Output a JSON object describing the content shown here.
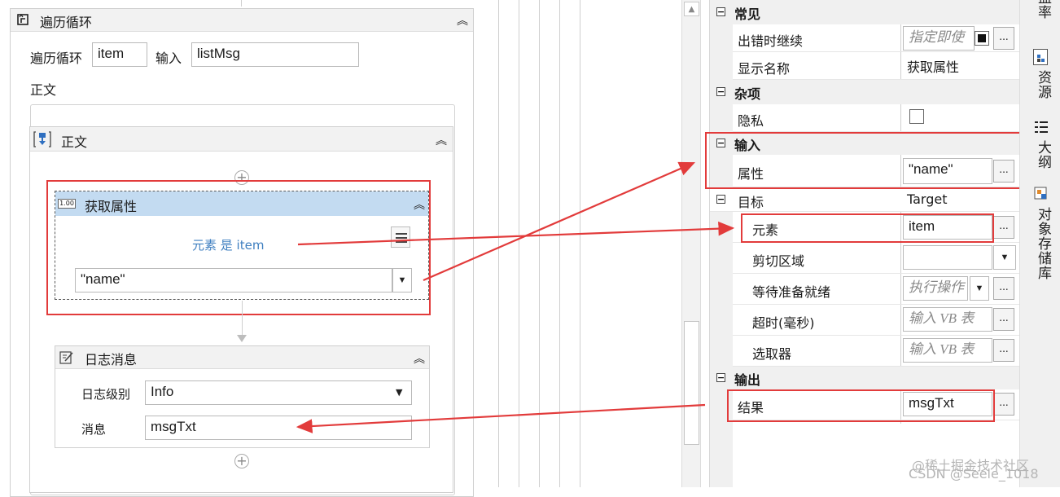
{
  "designer": {
    "foreach": {
      "title": "遍历循环",
      "loop_label": "遍历循环",
      "item_value": "item",
      "input_label": "输入",
      "input_value": "listMsg",
      "body_label": "正文"
    },
    "body_sequence": {
      "title": "正文"
    },
    "get_attribute": {
      "title": "获取属性",
      "element_hint": "元素 是 item",
      "attribute_value": "\"name\""
    },
    "log_message": {
      "title": "日志消息",
      "level_label": "日志级别",
      "level_value": "Info",
      "message_label": "消息",
      "message_value": "msgTxt"
    }
  },
  "properties": {
    "common": {
      "header": "常见",
      "continue_on_error_label": "出错时继续",
      "continue_on_error_placeholder": "指定即使",
      "display_name_label": "显示名称",
      "display_name_value": "获取属性"
    },
    "misc": {
      "header": "杂项",
      "private_label": "隐私"
    },
    "input": {
      "header": "输入",
      "attribute_label": "属性",
      "attribute_value": "\"name\""
    },
    "target": {
      "header": "目标",
      "header_value": "Target",
      "element_label": "元素",
      "element_value": "item",
      "clipping_label": "剪切区域",
      "wait_ready_label": "等待准备就绪",
      "wait_ready_placeholder": "执行操作",
      "timeout_label": "超时(毫秒)",
      "timeout_placeholder": "输入 VB 表",
      "selector_label": "选取器",
      "selector_placeholder": "输入 VB 表"
    },
    "output": {
      "header": "输出",
      "result_label": "结果",
      "result_value": "msgTxt"
    },
    "ellipsis": "..."
  },
  "side_tabs": [
    "覆盖率",
    "资源",
    "大纲",
    "对象存储库"
  ],
  "watermark": "CSDN @Seele_1018",
  "watermark2": "@稀土掘金技术社区",
  "colors": {
    "annotation_red": "#e23b3b",
    "activity_header_blue": "#c3dbf1",
    "hint_blue": "#3f7fc0"
  }
}
